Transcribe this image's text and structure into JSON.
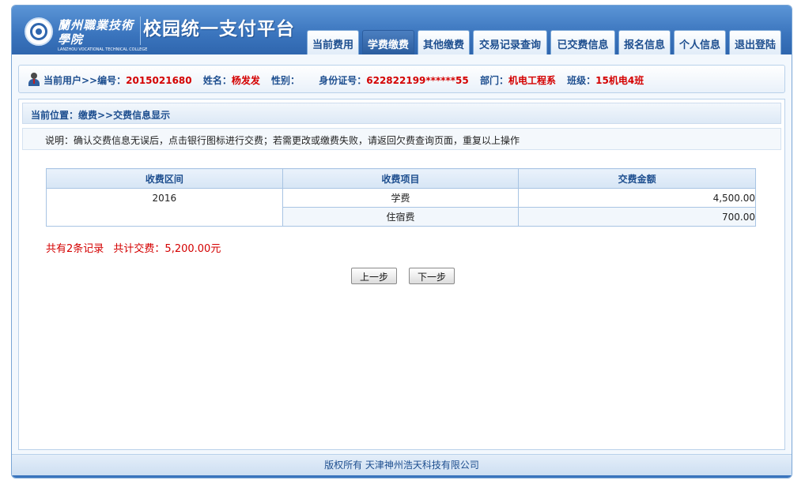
{
  "header": {
    "school_name": "蘭州職業技術學院",
    "school_name_en": "LANZHOU VOCATIONAL TECHNICAL COLLEGE",
    "site_title": "校园统一支付平台"
  },
  "nav": {
    "tabs": [
      {
        "label": "当前费用"
      },
      {
        "label": "学费缴费"
      },
      {
        "label": "其他缴费"
      },
      {
        "label": "交易记录查询"
      },
      {
        "label": "已交费信息"
      },
      {
        "label": "报名信息"
      },
      {
        "label": "个人信息"
      },
      {
        "label": "退出登陆"
      }
    ],
    "active": "学费缴费"
  },
  "user": {
    "prefix": "当前用户>>编号：",
    "id": "2015021680",
    "name_label": "姓名：",
    "name": "杨发发",
    "gender_label": "性别：",
    "gender": "",
    "idcard_label": "身份证号：",
    "idcard": "622822199******55",
    "dept_label": "部门：",
    "dept": "机电工程系",
    "class_label": "班级：",
    "class": "15机电4班"
  },
  "breadcrumb": "当前位置：缴费>>交费信息显示",
  "notice": "说明：确认交费信息无误后，点击银行图标进行交费；若需更改或缴费失败，请返回欠费查询页面，重复以上操作",
  "fee_table": {
    "headers": [
      "收费区间",
      "收费项目",
      "交费金额"
    ],
    "period": "2016",
    "rows": [
      {
        "item": "学费",
        "amount": "4,500.00"
      },
      {
        "item": "住宿费",
        "amount": "700.00"
      }
    ]
  },
  "summary": {
    "records": "共有2条记录",
    "total": "共计交费：5,200.00元"
  },
  "buttons": {
    "prev": "上一步",
    "next": "下一步"
  },
  "footer": "版权所有 天津神州浩天科技有限公司",
  "colors": {
    "header_blue": "#3a74bd",
    "active_tab": "#2b5d9e",
    "highlight_red": "#d40000",
    "label_blue": "#1d4e8f"
  }
}
